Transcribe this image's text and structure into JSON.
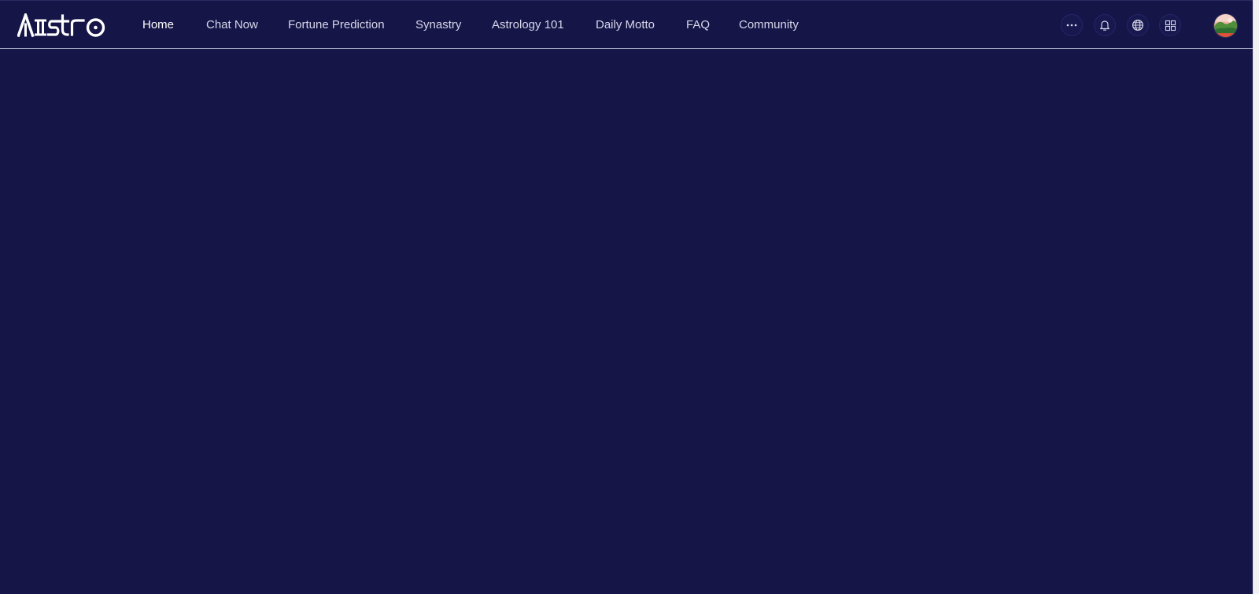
{
  "app": {
    "logo_text": "Astro"
  },
  "nav": {
    "items": [
      {
        "label": "Home",
        "active": true
      },
      {
        "label": "Chat Now",
        "active": false
      },
      {
        "label": "Fortune Prediction",
        "active": false
      },
      {
        "label": "Synastry",
        "active": false
      },
      {
        "label": "Astrology 101",
        "active": false
      },
      {
        "label": "Daily Motto",
        "active": false
      },
      {
        "label": "FAQ",
        "active": false
      },
      {
        "label": "Community",
        "active": false
      }
    ]
  },
  "toolbar": {
    "icons": [
      "more-icon",
      "bell-icon",
      "globe-icon",
      "grid-icon"
    ],
    "avatar": "user-avatar"
  },
  "colors": {
    "background": "#151548",
    "header_divider": "#b7b7d2",
    "text": "#d7d7ea",
    "active_text": "#ffffff"
  }
}
